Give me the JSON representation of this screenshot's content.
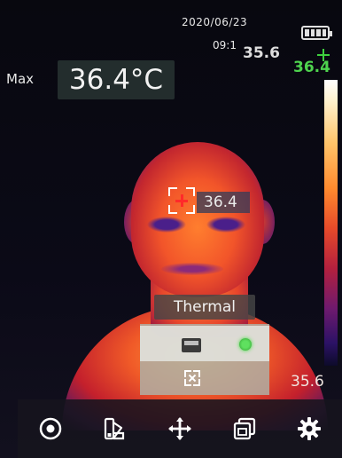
{
  "status": {
    "date": "2020/06/23",
    "time": "09:1",
    "battery_icon": "battery-full-icon"
  },
  "readouts": {
    "max_label": "Max",
    "max_value": "36.4°C",
    "cursor_temp_gray": "35.6",
    "cursor_temp_green": "36.4",
    "face_temp": "36.4",
    "scale_min": "35.6"
  },
  "mode_menu": {
    "label": "Thermal",
    "options": [
      {
        "icon": "thermal-mode-icon",
        "selected": true
      },
      {
        "icon": "fusion-mode-icon",
        "selected": false
      }
    ]
  },
  "toolbar": {
    "items": [
      {
        "icon": "capture-icon"
      },
      {
        "icon": "palette-icon"
      },
      {
        "icon": "move-icon"
      },
      {
        "icon": "gallery-icon"
      },
      {
        "icon": "settings-icon"
      }
    ]
  },
  "colors": {
    "accent_green": "#4ed34e",
    "marker_red": "#ff2a2a",
    "ui_text": "#e8e8e8"
  }
}
